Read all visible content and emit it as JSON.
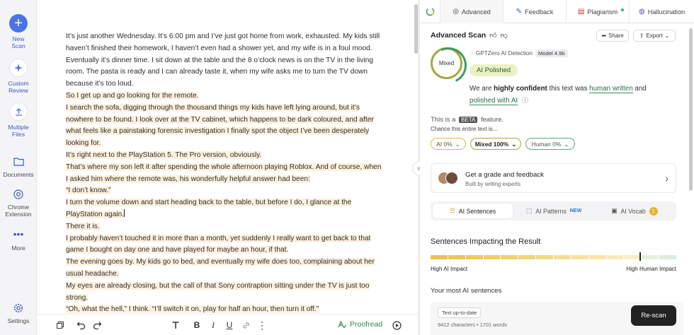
{
  "rail": {
    "new_scan": "New\nScan",
    "custom_review": "Custom\nReview",
    "multiple_files": "Multiple\nFiles",
    "documents": "Documents",
    "chrome_extension": "Chrome\nExtension",
    "more": "More",
    "settings": "Settings"
  },
  "document": {
    "paragraphs": [
      {
        "text": "It’s just another Wednesday. It’s 6:00 pm and I’ve just got home from work, exhausted. My kids still haven’t finished their homework, I haven’t even had a shower yet, and my wife is in a foul mood. Eventually it’s dinner time. I sit down at the table and the 8 o’clock news is on the TV in the living room. The pasta is ready and I can already taste it, when my wife asks me to turn the TV down because it’s too loud.",
        "highlight": false
      },
      {
        "text": "So I get up and go looking for the remote.",
        "highlight": true
      },
      {
        "text": "I search the sofa, digging through the thousand things my kids have left lying around, but it’s nowhere to be found. I look over at the TV cabinet, which happens to be dark coloured, and after what feels like a painstaking forensic investigation I finally spot the object I’ve been desperately looking for.",
        "highlight": true
      },
      {
        "text": "It’s right next to the PlayStation 5. The Pro version, obviously.",
        "highlight": true
      },
      {
        "text": "That’s where my son left it after spending the whole afternoon playing Roblox. And of course, when I asked him where the remote was, his wonderfully helpful answer had been:",
        "highlight": true
      },
      {
        "text": "“I don’t know.”",
        "highlight": true
      },
      {
        "text": "I turn the volume down and start heading back to the table, but before I do, I glance at the PlayStation again.",
        "highlight": true,
        "caret": true
      },
      {
        "text": "There it is.",
        "highlight": true
      },
      {
        "text": "I probably haven’t touched it in more than a month, yet suddenly I really want to get back to that game I bought on day one and have played for maybe an hour, if that.",
        "highlight": true
      },
      {
        "text": "The evening goes by. My kids go to bed, and eventually my wife does too, complaining about her usual headache.",
        "highlight": true
      },
      {
        "text": "My eyes are already closing, but the call of that Sony contraption sitting under the TV is just too strong.",
        "highlight": true
      },
      {
        "text": "“Oh, what the hell,” I think. “I’ll switch it on, play for half an hour, then turn it off.”",
        "highlight": true
      }
    ]
  },
  "toolbar": {
    "proofread": "Proofread"
  },
  "tabs": {
    "advanced": "Advanced",
    "feedback": "Feedback",
    "plagiarism": "Plagiarism",
    "hallucination": "Hallucination"
  },
  "scan": {
    "title": "Advanced Scan",
    "share": "Share",
    "export": "Export",
    "ring_label": "Mixed",
    "detector": "GPTZero AI Detection",
    "model": "Model 4.9b",
    "verdict": "AI Polished",
    "confidence_pre": "We are ",
    "confidence_strong": "highly confident",
    "confidence_mid": " this text was ",
    "confidence_link1": "human written",
    "confidence_and": "  and",
    "confidence_link2": "polished with AI",
    "beta_pre": "This is a ",
    "beta_tag": "BETA",
    "beta_post": " feature.",
    "chance": "Chance this entire text is...",
    "chips": [
      "AI 0%",
      "Mixed 100%",
      "Human 0%"
    ]
  },
  "grade": {
    "title": "Get a grade and feedback",
    "subtitle": "Built by writing experts"
  },
  "segments": {
    "ai_sentences": "AI Sentences",
    "ai_patterns": "AI Patterns",
    "new": "NEW",
    "ai_vocab": "AI Vocab",
    "vocab_count": "1"
  },
  "impact": {
    "title": "Sentences Impacting the Result",
    "left": "High AI Impact",
    "right": "High Human Impact"
  },
  "your_ai": "Your most AI sentences",
  "footer": {
    "up_to_date": "Text up-to-date",
    "stats": "9412 characters • 1701 words",
    "rescan": "Re-scan"
  },
  "colors": {
    "accent_blue": "#4a74e6",
    "highlight": "#fdf1de",
    "mixed_olive": "#a6a93f",
    "human_green": "#3d9a5f",
    "ai_yellow": "#e4b431"
  }
}
